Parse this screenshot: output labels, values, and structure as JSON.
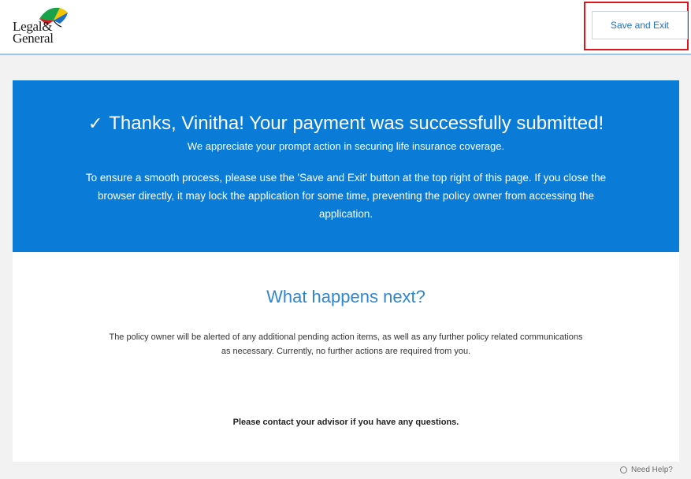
{
  "header": {
    "logo_line1": "Legal&",
    "logo_line2": "General",
    "save_exit_label": "Save and Exit"
  },
  "banner": {
    "check_glyph": "✓",
    "title": "Thanks, Vinitha! Your payment was successfully submitted!",
    "subtitle": "We appreciate your prompt action in securing life insurance coverage.",
    "body": "To ensure a smooth process, please use the 'Save and Exit' button at the top right of this page. If you close the browser directly, it may lock the application for some time, preventing the policy owner from accessing the application."
  },
  "next": {
    "title": "What happens next?",
    "body": "The policy owner will be alerted of any additional pending action items, as well as any further policy related communications as necessary. Currently, no further actions are required from you.",
    "contact": "Please contact your advisor if you have any questions."
  },
  "help": {
    "label": "Need Help?"
  },
  "colors": {
    "banner_bg": "#0a7bd7",
    "accent_blue": "#2f86d1",
    "highlight_red": "#e0141c"
  }
}
